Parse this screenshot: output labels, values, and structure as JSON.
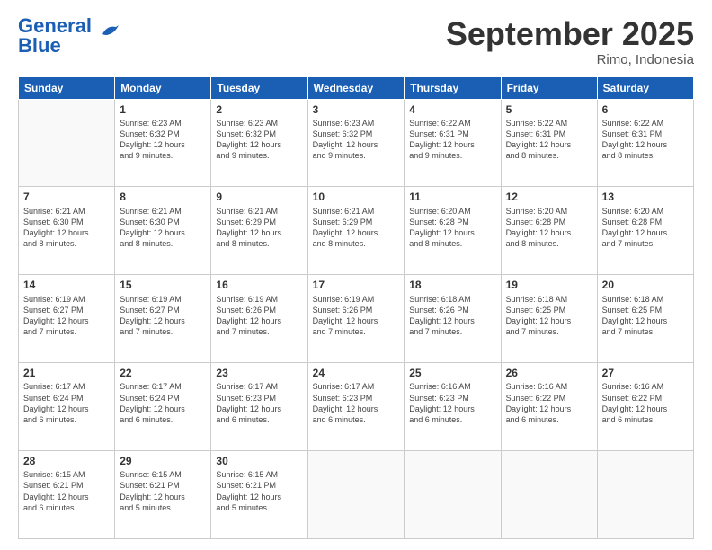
{
  "logo": {
    "line1": "General",
    "line2": "Blue"
  },
  "title": "September 2025",
  "subtitle": "Rimo, Indonesia",
  "days_of_week": [
    "Sunday",
    "Monday",
    "Tuesday",
    "Wednesday",
    "Thursday",
    "Friday",
    "Saturday"
  ],
  "weeks": [
    [
      {
        "day": "",
        "info": ""
      },
      {
        "day": "1",
        "info": "Sunrise: 6:23 AM\nSunset: 6:32 PM\nDaylight: 12 hours\nand 9 minutes."
      },
      {
        "day": "2",
        "info": "Sunrise: 6:23 AM\nSunset: 6:32 PM\nDaylight: 12 hours\nand 9 minutes."
      },
      {
        "day": "3",
        "info": "Sunrise: 6:23 AM\nSunset: 6:32 PM\nDaylight: 12 hours\nand 9 minutes."
      },
      {
        "day": "4",
        "info": "Sunrise: 6:22 AM\nSunset: 6:31 PM\nDaylight: 12 hours\nand 9 minutes."
      },
      {
        "day": "5",
        "info": "Sunrise: 6:22 AM\nSunset: 6:31 PM\nDaylight: 12 hours\nand 8 minutes."
      },
      {
        "day": "6",
        "info": "Sunrise: 6:22 AM\nSunset: 6:31 PM\nDaylight: 12 hours\nand 8 minutes."
      }
    ],
    [
      {
        "day": "7",
        "info": "Sunrise: 6:21 AM\nSunset: 6:30 PM\nDaylight: 12 hours\nand 8 minutes."
      },
      {
        "day": "8",
        "info": "Sunrise: 6:21 AM\nSunset: 6:30 PM\nDaylight: 12 hours\nand 8 minutes."
      },
      {
        "day": "9",
        "info": "Sunrise: 6:21 AM\nSunset: 6:29 PM\nDaylight: 12 hours\nand 8 minutes."
      },
      {
        "day": "10",
        "info": "Sunrise: 6:21 AM\nSunset: 6:29 PM\nDaylight: 12 hours\nand 8 minutes."
      },
      {
        "day": "11",
        "info": "Sunrise: 6:20 AM\nSunset: 6:28 PM\nDaylight: 12 hours\nand 8 minutes."
      },
      {
        "day": "12",
        "info": "Sunrise: 6:20 AM\nSunset: 6:28 PM\nDaylight: 12 hours\nand 8 minutes."
      },
      {
        "day": "13",
        "info": "Sunrise: 6:20 AM\nSunset: 6:28 PM\nDaylight: 12 hours\nand 7 minutes."
      }
    ],
    [
      {
        "day": "14",
        "info": "Sunrise: 6:19 AM\nSunset: 6:27 PM\nDaylight: 12 hours\nand 7 minutes."
      },
      {
        "day": "15",
        "info": "Sunrise: 6:19 AM\nSunset: 6:27 PM\nDaylight: 12 hours\nand 7 minutes."
      },
      {
        "day": "16",
        "info": "Sunrise: 6:19 AM\nSunset: 6:26 PM\nDaylight: 12 hours\nand 7 minutes."
      },
      {
        "day": "17",
        "info": "Sunrise: 6:19 AM\nSunset: 6:26 PM\nDaylight: 12 hours\nand 7 minutes."
      },
      {
        "day": "18",
        "info": "Sunrise: 6:18 AM\nSunset: 6:26 PM\nDaylight: 12 hours\nand 7 minutes."
      },
      {
        "day": "19",
        "info": "Sunrise: 6:18 AM\nSunset: 6:25 PM\nDaylight: 12 hours\nand 7 minutes."
      },
      {
        "day": "20",
        "info": "Sunrise: 6:18 AM\nSunset: 6:25 PM\nDaylight: 12 hours\nand 7 minutes."
      }
    ],
    [
      {
        "day": "21",
        "info": "Sunrise: 6:17 AM\nSunset: 6:24 PM\nDaylight: 12 hours\nand 6 minutes."
      },
      {
        "day": "22",
        "info": "Sunrise: 6:17 AM\nSunset: 6:24 PM\nDaylight: 12 hours\nand 6 minutes."
      },
      {
        "day": "23",
        "info": "Sunrise: 6:17 AM\nSunset: 6:23 PM\nDaylight: 12 hours\nand 6 minutes."
      },
      {
        "day": "24",
        "info": "Sunrise: 6:17 AM\nSunset: 6:23 PM\nDaylight: 12 hours\nand 6 minutes."
      },
      {
        "day": "25",
        "info": "Sunrise: 6:16 AM\nSunset: 6:23 PM\nDaylight: 12 hours\nand 6 minutes."
      },
      {
        "day": "26",
        "info": "Sunrise: 6:16 AM\nSunset: 6:22 PM\nDaylight: 12 hours\nand 6 minutes."
      },
      {
        "day": "27",
        "info": "Sunrise: 6:16 AM\nSunset: 6:22 PM\nDaylight: 12 hours\nand 6 minutes."
      }
    ],
    [
      {
        "day": "28",
        "info": "Sunrise: 6:15 AM\nSunset: 6:21 PM\nDaylight: 12 hours\nand 6 minutes."
      },
      {
        "day": "29",
        "info": "Sunrise: 6:15 AM\nSunset: 6:21 PM\nDaylight: 12 hours\nand 5 minutes."
      },
      {
        "day": "30",
        "info": "Sunrise: 6:15 AM\nSunset: 6:21 PM\nDaylight: 12 hours\nand 5 minutes."
      },
      {
        "day": "",
        "info": ""
      },
      {
        "day": "",
        "info": ""
      },
      {
        "day": "",
        "info": ""
      },
      {
        "day": "",
        "info": ""
      }
    ]
  ]
}
